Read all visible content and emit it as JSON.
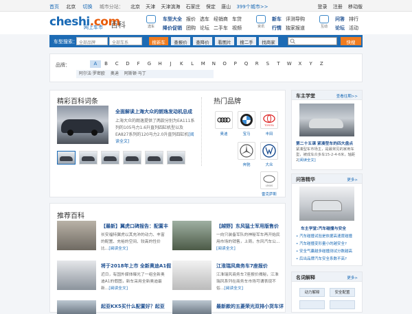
{
  "topbar": {
    "links": [
      "首页",
      "北京",
      "切换",
      "城市分站："
    ],
    "cities": [
      "北京",
      "天津",
      "天津滨海",
      "石家庄",
      "保定",
      "唐山",
      "399个城市>>"
    ],
    "right": [
      "登录",
      "注册",
      "移动版"
    ]
  },
  "header": {
    "brand": "cheshi",
    "brand_tld": ".com",
    "brand_sub": "网上车市",
    "section": "百科",
    "nav_icons": [
      {
        "icon": "car-icon",
        "label": "选车"
      },
      {
        "icon": "news-icon",
        "label": "资讯"
      },
      {
        "icon": "interact-icon",
        "label": "互动"
      }
    ],
    "nav_groups": [
      {
        "rows": [
          [
            "车型大全",
            "报价",
            "选车",
            "经销商",
            "车贷"
          ],
          [
            "降价促销",
            "团购",
            "论坛",
            "二手车",
            "视频"
          ]
        ]
      },
      {
        "rows": [
          [
            "新车",
            "评测导购"
          ],
          [
            "行情",
            "独家报道"
          ]
        ]
      },
      {
        "rows": [
          [
            "问答",
            "排行"
          ],
          [
            "论坛",
            "活动"
          ]
        ]
      }
    ]
  },
  "searchbar": {
    "label": "车型搜索：",
    "brand_select": "全部品牌",
    "series_select": "全部车系",
    "buttons": [
      "搜新车",
      "查报价",
      "查降价",
      "看图片",
      "搜二手",
      "找商家"
    ],
    "search_button": "快搜"
  },
  "brands": {
    "label": "品牌：",
    "letters": [
      "A",
      "B",
      "C",
      "D",
      "F",
      "G",
      "H",
      "J",
      "K",
      "L",
      "M",
      "N",
      "O",
      "P",
      "Q",
      "R",
      "S",
      "T",
      "W",
      "X",
      "Y",
      "Z"
    ],
    "active_letter": "A",
    "sub_brands": [
      "阿尔法·罗密欧",
      "奥迪",
      "阿斯顿·马丁"
    ]
  },
  "featured": {
    "title": "精彩百科词条",
    "headline": "全面解读上海大众的朗逸发动机总成",
    "body": "上海大众的朗逸提供了两款分别为EA111系列的105马力1.6升直列四缸机型以及EA827系列的120马力2.0升直列四缸机",
    "read_more": "[阅读全文]"
  },
  "hot_brands": {
    "title": "热门品牌",
    "items": [
      {
        "name": "奥迪",
        "icon": "audi-logo-icon"
      },
      {
        "name": "宝马",
        "icon": "bmw-logo-icon"
      },
      {
        "name": "丰田",
        "icon": "toyota-logo-icon"
      },
      {
        "name": "奔驰",
        "icon": "benz-logo-icon"
      },
      {
        "name": "大众",
        "icon": "vw-logo-icon"
      },
      {
        "name": "雷克萨斯",
        "icon": "lexus-logo-icon"
      }
    ],
    "logo_texts": {
      "toyota": "TOYOTA",
      "lexus": "LEXUS"
    }
  },
  "recommended": {
    "title": "推荐百科",
    "items": [
      {
        "title": "【最新】翼虎口碑报告：配置丰",
        "text": "长安福特翼虎以其充沛的动力、丰富的配置、充裕的空间、较高的性价比...",
        "more": "[阅读全文]"
      },
      {
        "title": "【越野】东风猛士军用版售价",
        "text": "一向只装备军队的神秘军车再开始民用市场的销售，上周，东风汽车公...",
        "more": "[阅读全文]"
      },
      {
        "title": "将于2018年上市 全新奥迪A1假",
        "text": "近日，有国外媒体曝光了一组全新奥迪A1的假图，新车采用全新奥迪最新...",
        "more": "[阅读全文]"
      },
      {
        "title": "江淮瑞风商务车7座报价",
        "text": "江淮瑞风商务车7座报价揭秘，江淮瑞风系列在商务车市场可谓表现不俗...",
        "more": "[阅读全文]"
      },
      {
        "title": "起亚KX5买什么配置好？起亚",
        "text": "",
        "more": ""
      },
      {
        "title": "最新款的五菱荣光双排小货车详",
        "text": "",
        "more": ""
      }
    ]
  },
  "sidebar": {
    "school": {
      "title": "车主学堂",
      "more": "查看往期>>",
      "headline": "第二十五课 紧凑型车的四大盘点",
      "text": "紧凑型车市场主，是最常见的家用车型，被成车众多车15-2-4-6米，轴距2",
      "read_more": "[阅读全文]"
    },
    "qa": {
      "title": "问答精华",
      "more": "更多>",
      "headline": "车主学堂:汽车碰撞与安全",
      "items": [
        "汽车碰撞试验是依据高速度碰撞",
        "汽车碰撞变形量小的越安全?",
        "安全气囊越多碰撞测试分数越高",
        "后出品牌汽车安全系数不高?"
      ]
    },
    "terms": {
      "title": "名词解释",
      "more": "更多>",
      "buttons": [
        "动力解释",
        "安全配置",
        "",
        ""
      ]
    }
  }
}
